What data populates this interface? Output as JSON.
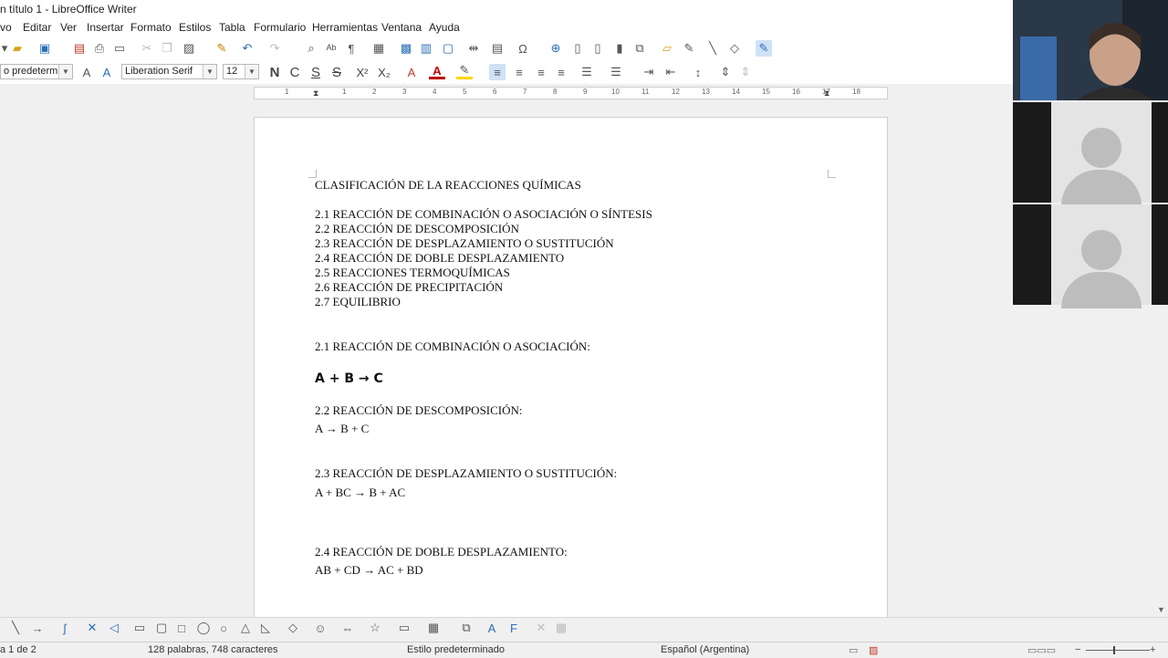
{
  "window": {
    "title": "n título 1 - LibreOffice Writer"
  },
  "menu": [
    "vo",
    "Editar",
    "Ver",
    "Insertar",
    "Formato",
    "Estilos",
    "Tabla",
    "Formulario",
    "Herramientas",
    "Ventana",
    "Ayuda"
  ],
  "format_bar": {
    "paragraph_style": "o predetermin",
    "font_name": "Liberation Serif",
    "font_size": "12",
    "bold": "N",
    "italic": "C",
    "underline": "S",
    "strike": "S",
    "superscript": "X²",
    "subscript": "X₂"
  },
  "ruler": {
    "ticks": [
      "1",
      "1",
      "2",
      "3",
      "4",
      "5",
      "6",
      "7",
      "8",
      "9",
      "10",
      "11",
      "12",
      "13",
      "14",
      "15",
      "16",
      "17",
      "18"
    ]
  },
  "document": {
    "heading": "CLASIFICACIÓN DE LA REACCIONES QUÍMICAS",
    "toc": [
      "2.1 REACCIÓN DE COMBINACIÓN O ASOCIACIÓN O SÍNTESIS",
      "2.2 REACCIÓN DE DESCOMPOSICIÓN",
      "2.3 REACCIÓN DE DESPLAZAMIENTO O SUSTITUCIÓN",
      "2.4 REACCIÓN DE DOBLE DESPLAZAMIENTO",
      "2.5 REACCIONES TERMOQUÍMICAS",
      "2.6 REACCIÓN DE PRECIPITACIÓN",
      "2.7 EQUILIBRIO"
    ],
    "s1_title": "2.1 REACCIÓN DE COMBINACIÓN O ASOCIACIÓN:",
    "s1_eq": "A + B → C",
    "s2_title": "2.2 REACCIÓN DE DESCOMPOSICIÓN:",
    "s2_eq": "A  → B + C",
    "s3_title": "2.3 REACCIÓN DE DESPLAZAMIENTO O SUSTITUCIÓN:",
    "s3_eq": "A + BC →  B + AC",
    "s4_title": "2.4 REACCIÓN DE DOBLE DESPLAZAMIENTO:",
    "s4_eq": "AB + CD →  AC + BD"
  },
  "status": {
    "page": "a 1 de 2",
    "words": "128 palabras, 748 caracteres",
    "style": "Estilo predeterminado",
    "language": "Español (Argentina)"
  },
  "colors": {
    "accent": "#2b6fb6",
    "font_color": "#c00000",
    "highlight": "#ffd700"
  }
}
